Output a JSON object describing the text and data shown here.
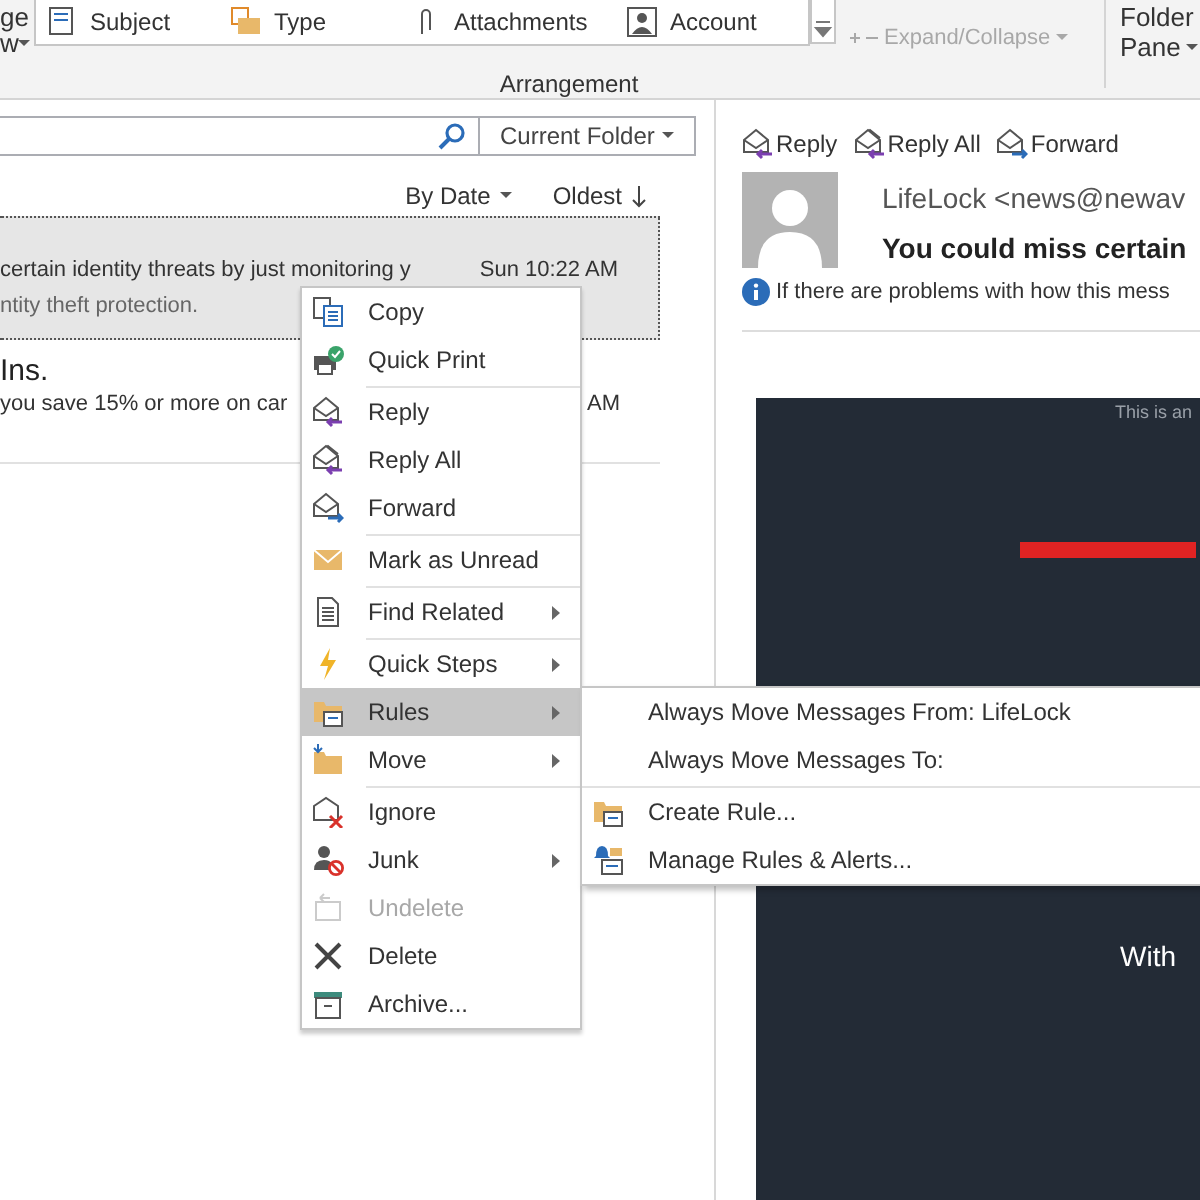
{
  "ribbon": {
    "left_fragment": [
      "ge",
      "w"
    ],
    "arrangement_items": [
      {
        "label": "Subject"
      },
      {
        "label": "Type"
      },
      {
        "label": "Attachments"
      },
      {
        "label": "Account"
      }
    ],
    "expand_collapse": {
      "label": "Expand/Collapse",
      "disabled": true
    },
    "group_label": "Arrangement",
    "folder_pane": [
      "Folder",
      "Pane"
    ]
  },
  "search": {
    "scope": "Current Folder"
  },
  "sort": {
    "by": "By Date",
    "order": "Oldest"
  },
  "messages": [
    {
      "preview": "certain identity threats by just monitoring y",
      "preview_2": "ntity theft protection.",
      "time": "Sun 10:22 AM",
      "selected": true
    },
    {
      "sender": "Ins.",
      "preview": "you save 15% or more on car",
      "time": "AM",
      "selected": false
    }
  ],
  "reading": {
    "actions": [
      "Reply",
      "Reply All",
      "Forward"
    ],
    "sender": "LifeLock <news@newav",
    "subject": "You could miss certain",
    "info": "If there are problems with how this mess",
    "email_texts": [
      "This is an",
      "With"
    ]
  },
  "context_menu": [
    {
      "kind": "item",
      "label": "Copy",
      "submenu": false,
      "disabled": false,
      "selected": false
    },
    {
      "kind": "item",
      "label": "Quick Print",
      "submenu": false,
      "disabled": false,
      "selected": false
    },
    {
      "kind": "separator"
    },
    {
      "kind": "item",
      "label": "Reply",
      "submenu": false,
      "disabled": false,
      "selected": false
    },
    {
      "kind": "item",
      "label": "Reply All",
      "submenu": false,
      "disabled": false,
      "selected": false
    },
    {
      "kind": "item",
      "label": "Forward",
      "submenu": false,
      "disabled": false,
      "selected": false
    },
    {
      "kind": "separator"
    },
    {
      "kind": "item",
      "label": "Mark as Unread",
      "submenu": false,
      "disabled": false,
      "selected": false
    },
    {
      "kind": "separator"
    },
    {
      "kind": "item",
      "label": "Find Related",
      "submenu": true,
      "disabled": false,
      "selected": false
    },
    {
      "kind": "separator"
    },
    {
      "kind": "item",
      "label": "Quick Steps",
      "submenu": true,
      "disabled": false,
      "selected": false
    },
    {
      "kind": "item",
      "label": "Rules",
      "submenu": true,
      "disabled": false,
      "selected": true
    },
    {
      "kind": "item",
      "label": "Move",
      "submenu": true,
      "disabled": false,
      "selected": false
    },
    {
      "kind": "separator"
    },
    {
      "kind": "item",
      "label": "Ignore",
      "submenu": false,
      "disabled": false,
      "selected": false
    },
    {
      "kind": "item",
      "label": "Junk",
      "submenu": true,
      "disabled": false,
      "selected": false
    },
    {
      "kind": "item",
      "label": "Undelete",
      "submenu": false,
      "disabled": true,
      "selected": false
    },
    {
      "kind": "item",
      "label": "Delete",
      "submenu": false,
      "disabled": false,
      "selected": false
    },
    {
      "kind": "item",
      "label": "Archive...",
      "submenu": false,
      "disabled": false,
      "selected": false
    }
  ],
  "submenu": [
    {
      "kind": "item",
      "label": "Always Move Messages From: LifeLock"
    },
    {
      "kind": "item",
      "label": "Always Move Messages To:"
    },
    {
      "kind": "separator"
    },
    {
      "kind": "item",
      "label": "Create Rule..."
    },
    {
      "kind": "item",
      "label": "Manage Rules & Alerts..."
    }
  ]
}
